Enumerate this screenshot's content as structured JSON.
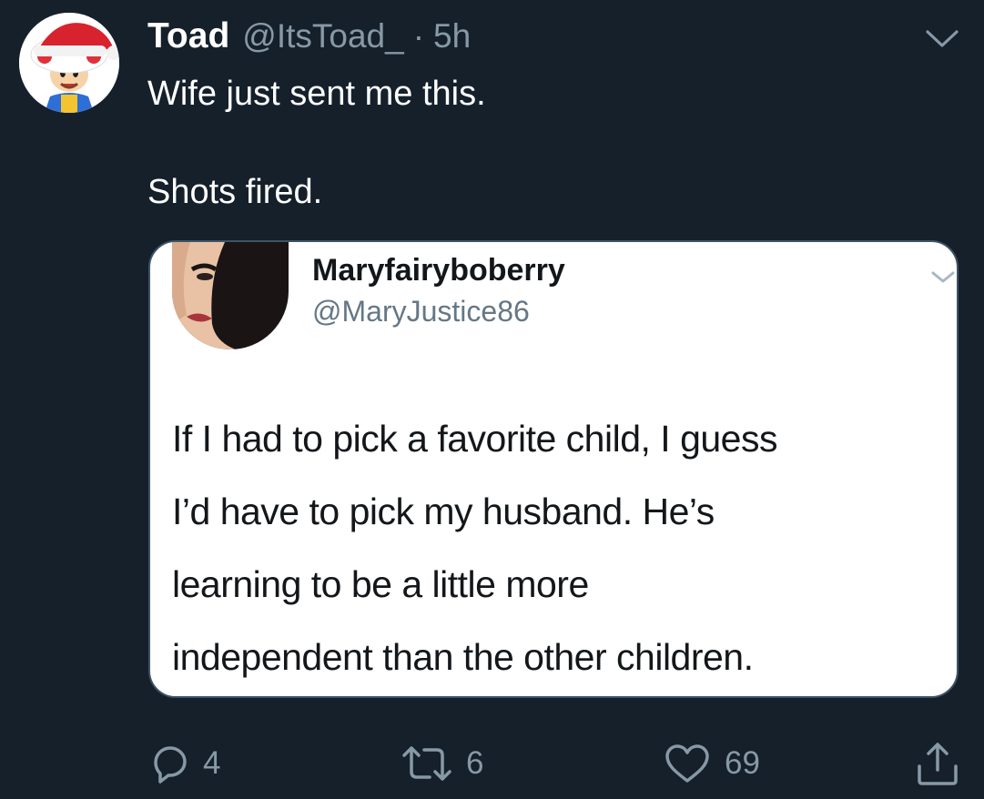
{
  "tweet": {
    "author_name": "Toad",
    "author_handle": "@ItsToad_",
    "separator": "·",
    "time": "5h",
    "text_lines": [
      "Wife just sent me this.",
      "Shots fired."
    ]
  },
  "quoted_image": {
    "author_name": "Maryfairyboberry",
    "author_handle": "@MaryJustice86",
    "text_lines": [
      "If I had to pick a favorite child, I guess",
      "I’d have to pick my husband. He’s",
      "learning to be a little more",
      "independent than the other children."
    ]
  },
  "actions": {
    "reply_count": "4",
    "retweet_count": "6",
    "like_count": "69"
  },
  "icons": {
    "reply": "reply-icon",
    "retweet": "retweet-icon",
    "like": "heart-icon",
    "share": "share-icon",
    "more": "chevron-down-icon"
  },
  "colors": {
    "background": "#15202b",
    "secondary_text": "#8899a6",
    "primary_text": "#ffffff",
    "card_background": "#ffffff"
  }
}
